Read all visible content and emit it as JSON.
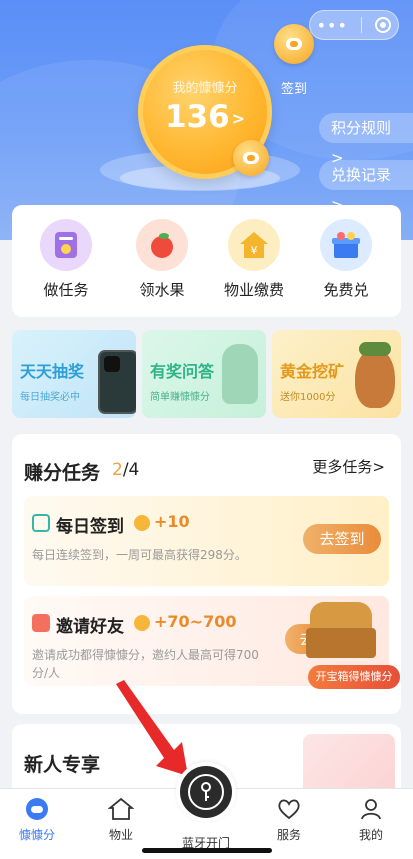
{
  "header": {
    "points_label": "我的慷慷分",
    "points_value": "136",
    "points_arrow": ">",
    "checkin_label": "签到",
    "rules_label": "积分规则 >",
    "records_label": "兑换记录 >"
  },
  "categories": [
    {
      "label": "做任务",
      "icon": "task-scroll-icon"
    },
    {
      "label": "领水果",
      "icon": "apple-icon"
    },
    {
      "label": "物业缴费",
      "icon": "house-yen-icon"
    },
    {
      "label": "免费兑",
      "icon": "gift-box-icon"
    }
  ],
  "banners": [
    {
      "title": "天天抽奖",
      "subtitle": "每日抽奖必中"
    },
    {
      "title": "有奖问答",
      "subtitle": "简单赚慷慷分"
    },
    {
      "title": "黄金挖矿",
      "subtitle": "送你1000分"
    }
  ],
  "earn": {
    "title": "赚分任务",
    "done": "2",
    "total": "/4",
    "more_label": "更多任务>",
    "tasks": [
      {
        "name": "每日签到",
        "points": "+10",
        "desc": "每日连续签到，一周可最高获得298分。",
        "button": "去签到"
      },
      {
        "name": "邀请好友",
        "points": "+70~700",
        "desc1": "邀请成功都得慷慷分，邀约人最高可得700",
        "desc2": "分/人",
        "button": "去"
      }
    ],
    "chest_label": "开宝箱得慷慷分"
  },
  "newbie": {
    "title": "新人专享"
  },
  "tabbar": {
    "items": [
      {
        "label": "慷慷分"
      },
      {
        "label": "物业"
      },
      {
        "label": "蓝牙开门"
      },
      {
        "label": "服务"
      },
      {
        "label": "我的"
      }
    ]
  },
  "colors": {
    "primary": "#3b7bf2",
    "accent_orange": "#e98c3a",
    "header_blue": "#5b8ff7"
  }
}
